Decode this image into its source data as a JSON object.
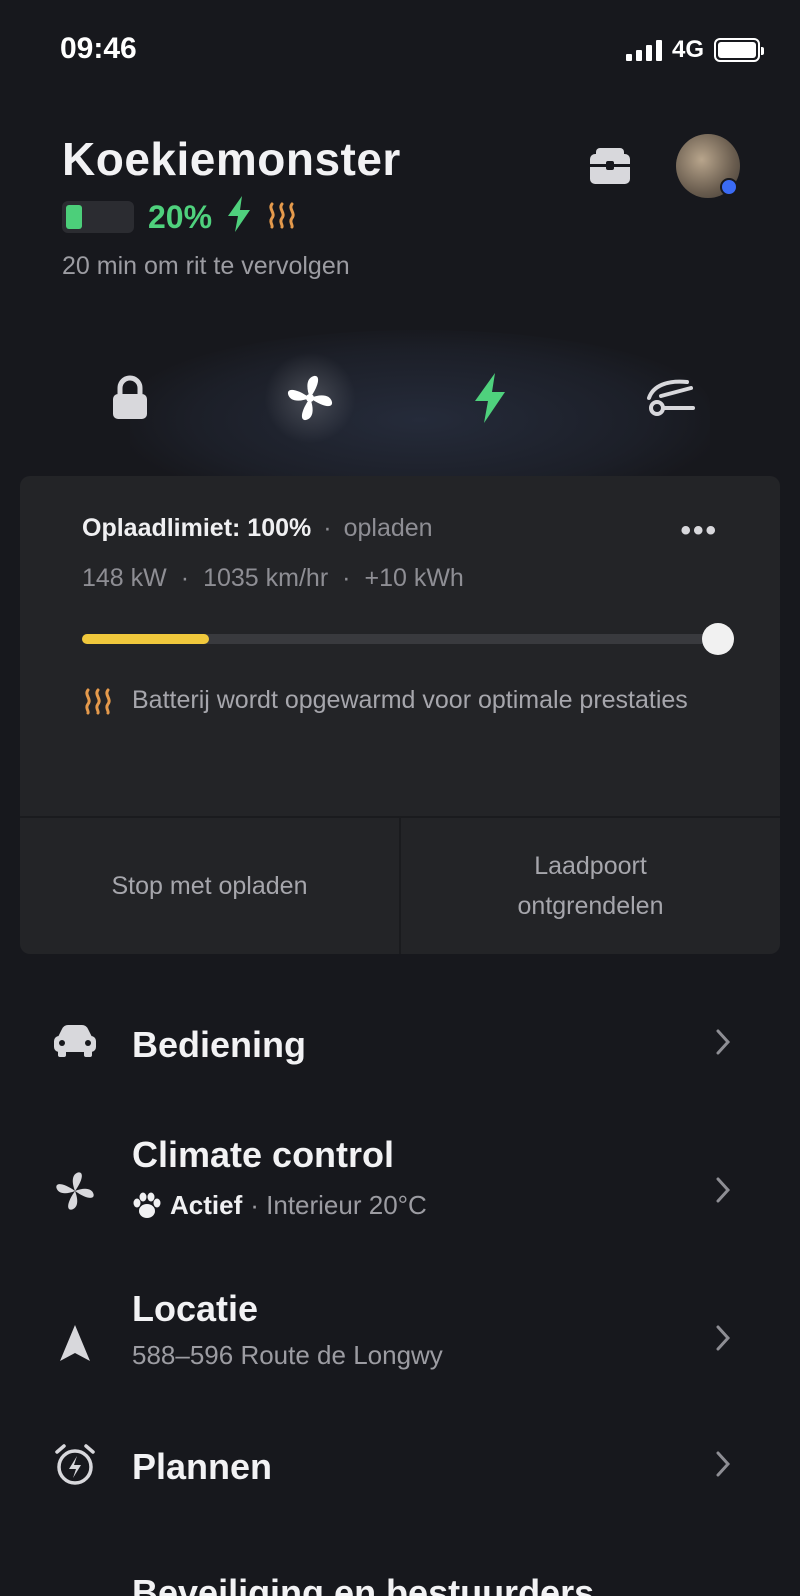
{
  "status_bar": {
    "time": "09:46",
    "network": "4G"
  },
  "vehicle": {
    "name": "Koekiemonster",
    "battery_percent": "20%",
    "battery_level": 0.2,
    "subtitle": "20 min om rit te vervolgen"
  },
  "quick_controls": [
    "lock-icon",
    "fan-icon",
    "charge-bolt-icon",
    "trunk-icon"
  ],
  "charging": {
    "limit_label": "Oplaadlimiet: 100%",
    "state": "opladen",
    "power": "148 kW",
    "rate": "1035 km/hr",
    "added": "+10 kWh",
    "charge_level": 0.2,
    "limit_level": 1.0,
    "warming_text": "Batterij wordt opgewarmd voor optimale prestaties",
    "stop_button": "Stop met opladen",
    "port_button_line1": "Laadpoort",
    "port_button_line2": "ontgrendelen"
  },
  "menu": {
    "controls": {
      "title": "Bediening"
    },
    "climate": {
      "title": "Climate control",
      "status": "Actief",
      "detail": "· Interieur 20°C"
    },
    "location": {
      "title": "Locatie",
      "address": "588–596 Route de Longwy"
    },
    "schedule": {
      "title": "Plannen"
    },
    "security": {
      "title": "Beveiliging en bestuurders"
    }
  },
  "colors": {
    "background": "#17181d",
    "card": "#232427",
    "accent_green": "#4fd17d",
    "heat_orange": "#e59a4c",
    "charge_yellow": "#f0c83c"
  }
}
